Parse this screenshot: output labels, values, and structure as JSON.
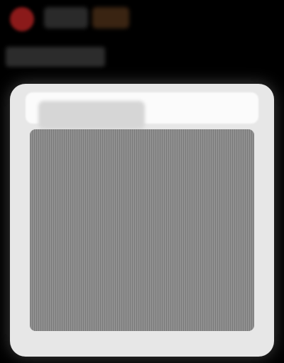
{
  "toolbar": {
    "close_label": "",
    "slot_1_label": "",
    "slot_2_label": ""
  },
  "header": {
    "title": ""
  },
  "window": {
    "tab_label": "",
    "content_text": ""
  },
  "colors": {
    "background": "#000000",
    "close_button": "#8b1a1a",
    "window": "#e7e7e7",
    "content": "#808080"
  },
  "icons": {
    "close": "close-icon"
  }
}
